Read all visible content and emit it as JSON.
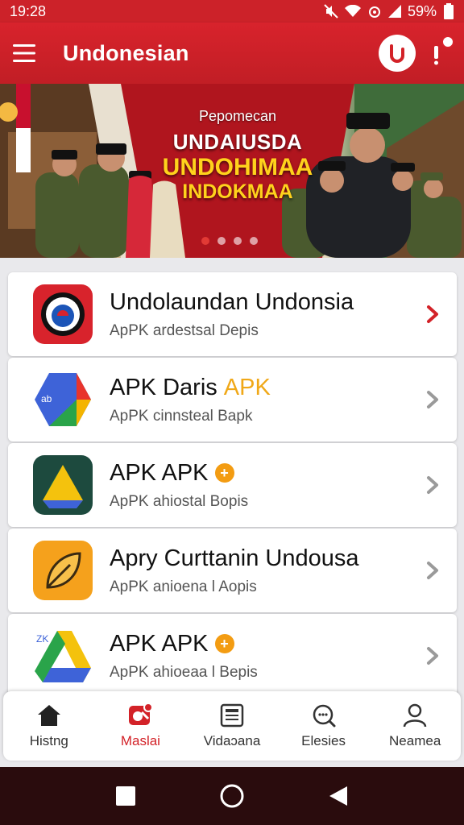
{
  "status_bar": {
    "time": "19:28",
    "battery": "59%"
  },
  "app_bar": {
    "title": "Undonesian",
    "logo_letter": "u"
  },
  "banner": {
    "subtitle": "Pepomecan",
    "line1": "UNDAIUSDA",
    "line2": "UNDOHIMAA",
    "line3": "INDOKMAA",
    "page_count": 4,
    "active_page": 1
  },
  "list": {
    "items": [
      {
        "title": "Undolaundan Undonsia",
        "title_accent": "",
        "badge": "",
        "subtitle": "ApPK ardestsal  Depis",
        "icon": "red-record-app-icon",
        "chevron_color": "#d32228"
      },
      {
        "title": "APK Daris",
        "title_accent": "APK",
        "badge": "",
        "subtitle": "ApPK cinnsteal  Bapk",
        "icon": "blue-google-app-icon",
        "chevron_color": "#9a9a9a"
      },
      {
        "title": "APK  APK",
        "title_accent": "",
        "badge": "+",
        "subtitle": "ApPK ahiostal  Bopis",
        "icon": "drive-triangle-icon",
        "chevron_color": "#9a9a9a"
      },
      {
        "title": "Apry Curttanin Undousa",
        "title_accent": "",
        "badge": "",
        "subtitle": "ApPK anioena l  Aopis",
        "icon": "orange-leaf-app-icon",
        "chevron_color": "#9a9a9a"
      },
      {
        "title": "APK APK",
        "title_accent": "",
        "badge": "+",
        "subtitle": "ApPK ahioeaa l  Bepis",
        "icon": "colorful-drive-icon",
        "chevron_color": "#9a9a9a"
      }
    ]
  },
  "bottom_nav": {
    "items": [
      {
        "label": "Histng",
        "icon": "home-icon",
        "active": false
      },
      {
        "label": "Maslai",
        "icon": "apps-icon",
        "active": true
      },
      {
        "label": "Vidaɔana",
        "icon": "news-icon",
        "active": false
      },
      {
        "label": "Elesies",
        "icon": "chat-search-icon",
        "active": false
      },
      {
        "label": "Neamea",
        "icon": "profile-icon",
        "active": false
      }
    ]
  },
  "colors": {
    "brand_red": "#d32228",
    "accent_orange": "#f39c12",
    "system_nav": "#2a0c0d"
  }
}
